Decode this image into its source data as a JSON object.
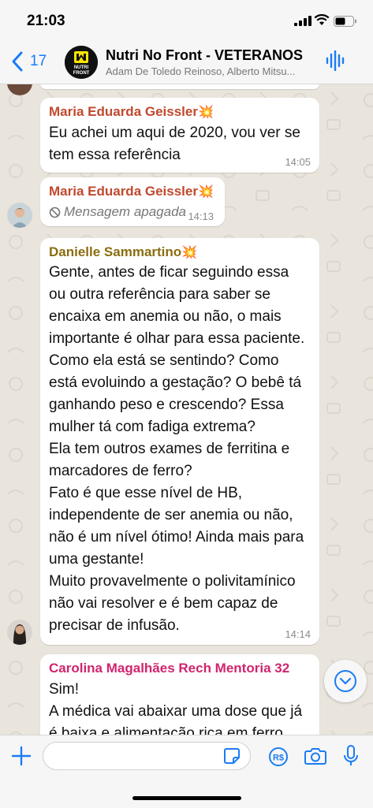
{
  "status": {
    "time": "21:03"
  },
  "header": {
    "back_count": "17",
    "title": "Nutri No Front - VETERANOS",
    "members": "Adam De Toledo Reinoso, Alberto Mitsu...",
    "logo_line1": "NUTRI",
    "logo_line2": "FRONT"
  },
  "messages": [
    {
      "sender": "Maria Eduarda Geissler",
      "emoji": "💥",
      "text": "Eu achei um aqui de 2020, vou ver se\ntem essa referência",
      "time": "14:05",
      "color": "#c0492e"
    },
    {
      "sender": "Maria Eduarda Geissler",
      "emoji": "💥",
      "text": "Mensagem apagada",
      "time": "14:13",
      "color": "#c0492e",
      "deleted": true
    },
    {
      "sender": "Danielle Sammartino",
      "emoji": "💥",
      "text": "Gente, antes de ficar seguindo essa\nou outra referência para saber se\nencaixa em anemia ou não, o mais\nimportante é olhar para essa paciente.\nComo ela está se sentindo? Como\nestá evoluindo a gestação? O bebê tá\nganhando peso e crescendo? Essa\nmulher tá com fadiga extrema?\nEla tem outros exames de ferritina e\nmarcadores de ferro?\nFato é que esse nível de HB,\nindependente de ser anemia ou não,\nnão é um nível ótimo! Ainda mais para\numa gestante!\nMuito provavelmente o polivitamínico\nnão vai resolver e é bem capaz de\nprecisar de infusão.",
      "time": "14:14",
      "color": "#8a6d0f"
    },
    {
      "sender": "Carolina Magalhães Rech Mentoria 32",
      "text": "Sim!\nA médica vai abaixar uma dose que já\né baixa e alimentação rica em ferro",
      "color": "#d1246e"
    }
  ],
  "colors": {
    "accent": "#1b7cf4",
    "bubble": "#ffffff",
    "chat_bg": "#e9e4dc"
  }
}
